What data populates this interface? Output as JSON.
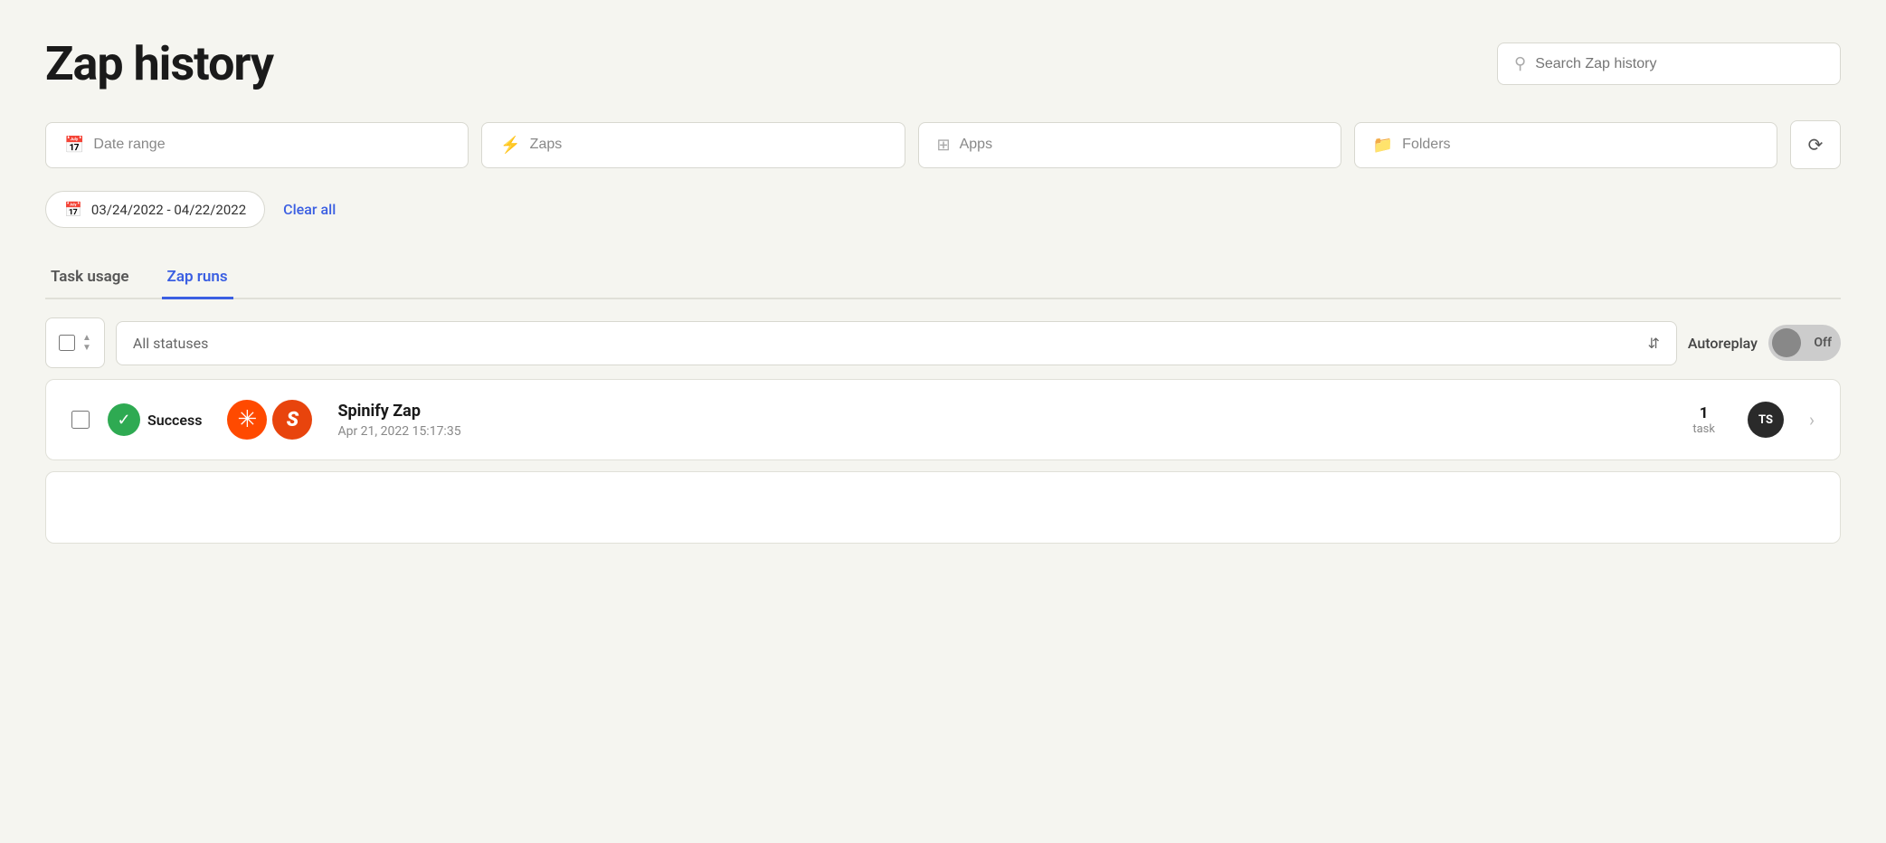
{
  "page": {
    "title": "Zap history"
  },
  "search": {
    "placeholder": "Search Zap history"
  },
  "filters": {
    "date_range_label": "Date range",
    "zaps_label": "Zaps",
    "apps_label": "Apps",
    "folders_label": "Folders",
    "active_date_range": "03/24/2022 - 04/22/2022",
    "clear_all_label": "Clear all"
  },
  "tabs": [
    {
      "id": "task-usage",
      "label": "Task usage",
      "active": false
    },
    {
      "id": "zap-runs",
      "label": "Zap runs",
      "active": true
    }
  ],
  "controls": {
    "status_placeholder": "All statuses",
    "autoreplay_label": "Autoreplay",
    "autoreplay_state": "Off"
  },
  "zap_rows": [
    {
      "status": "Success",
      "zap_name": "Spinify Zap",
      "zap_date": "Apr 21, 2022 15:17:35",
      "task_count": "1",
      "task_label": "task",
      "avatar_initials": "TS"
    }
  ]
}
